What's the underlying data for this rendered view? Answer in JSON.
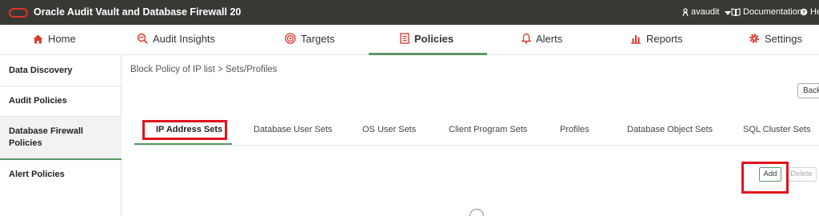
{
  "app": {
    "title": "Oracle Audit Vault and Database Firewall 20",
    "user": "avaudit",
    "documentation": "Documentation",
    "help": "He"
  },
  "mainnav": {
    "items": [
      {
        "label": "Home",
        "icon": "home-icon"
      },
      {
        "label": "Audit Insights",
        "icon": "magnifier-chart-icon"
      },
      {
        "label": "Targets",
        "icon": "target-icon"
      },
      {
        "label": "Policies",
        "icon": "policy-document-icon",
        "active": true
      },
      {
        "label": "Alerts",
        "icon": "bell-icon"
      },
      {
        "label": "Reports",
        "icon": "bar-chart-icon"
      },
      {
        "label": "Settings",
        "icon": "gear-icon"
      }
    ]
  },
  "sidebar": {
    "items": [
      {
        "label": "Data Discovery"
      },
      {
        "label": "Audit Policies"
      },
      {
        "label": "Database Firewall Policies",
        "active": true
      },
      {
        "label": "Alert Policies"
      }
    ]
  },
  "breadcrumb": "Block Policy of IP list > Sets/Profiles",
  "back_label": "Back",
  "subtabs": {
    "items": [
      {
        "label": "IP Address Sets",
        "active": true
      },
      {
        "label": "Database User Sets"
      },
      {
        "label": "OS User Sets"
      },
      {
        "label": "Client Program Sets"
      },
      {
        "label": "Profiles"
      },
      {
        "label": "Database Object Sets"
      },
      {
        "label": "SQL Cluster Sets"
      }
    ]
  },
  "actions": {
    "add_label": "Add",
    "delete_label": "Delete"
  },
  "colors": {
    "topbar": "#3a3835",
    "oracle_red": "#d9352a",
    "accent_green": "#5b9a68",
    "highlight_red": "#e0141c"
  }
}
